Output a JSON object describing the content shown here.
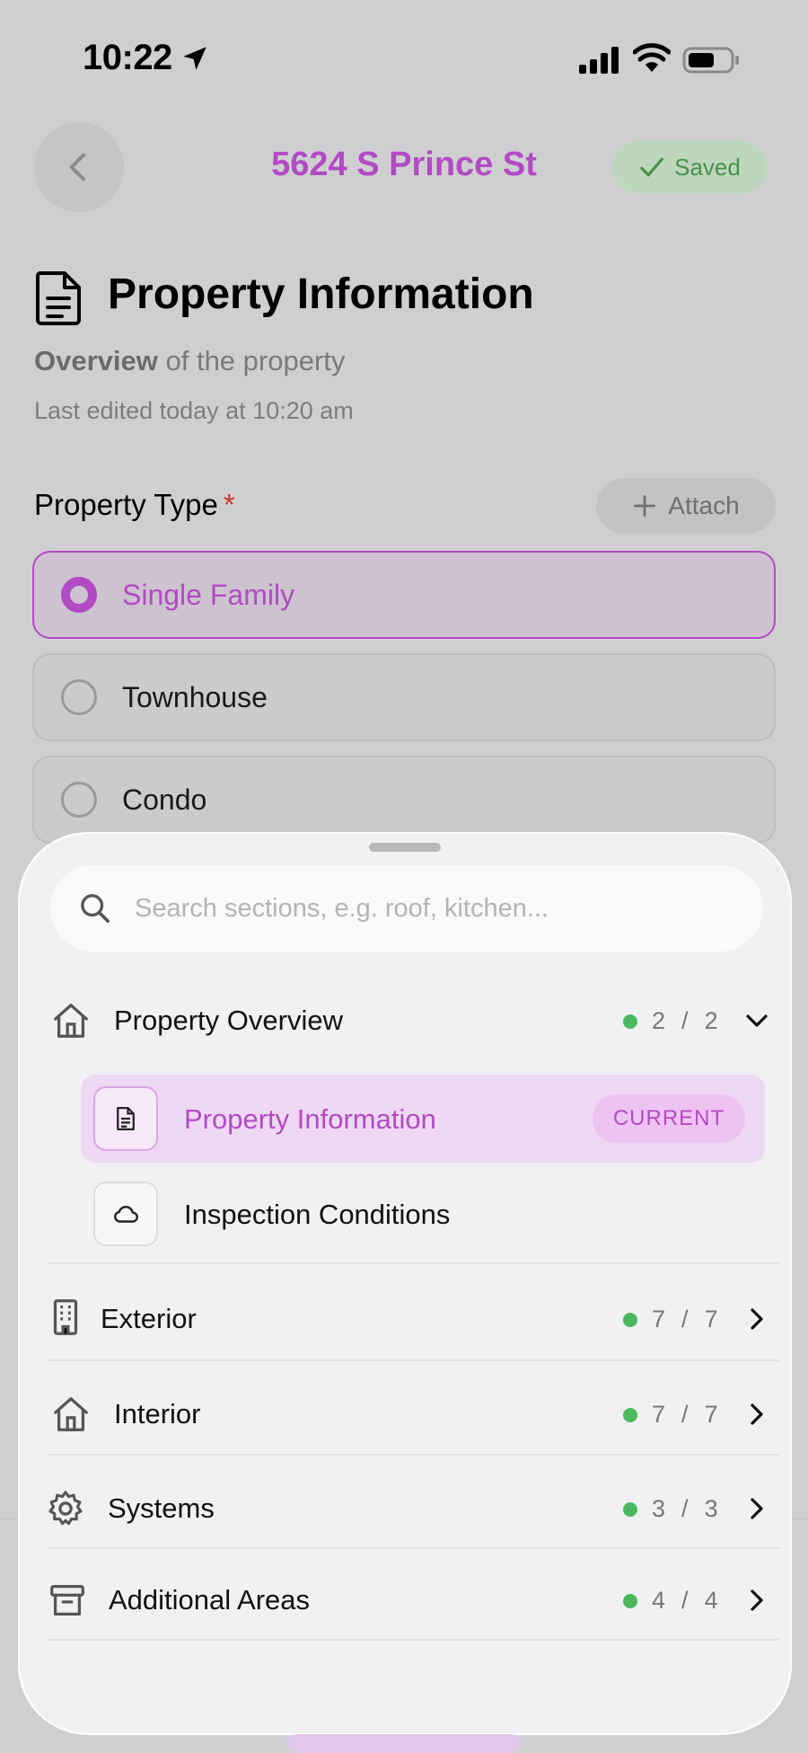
{
  "status_bar": {
    "time": "10:22"
  },
  "header": {
    "title": "5624 S Prince St",
    "saved_label": "Saved"
  },
  "page": {
    "title": "Property Information",
    "subtitle_bold": "Overview",
    "subtitle_rest": " of the property",
    "last_edited": "Last edited today at 10:20 am"
  },
  "field": {
    "label": "Property Type",
    "required_mark": "*",
    "attach_label": "Attach",
    "options": [
      "Single Family",
      "Townhouse",
      "Condo"
    ],
    "selected": "Single Family"
  },
  "sheet": {
    "search_placeholder": "Search sections, e.g. roof, kitchen...",
    "sections": [
      {
        "label": "Property Overview",
        "done": "2",
        "total": "2",
        "expanded": true,
        "icon": "house-icon"
      },
      {
        "label": "Exterior",
        "done": "7",
        "total": "7",
        "icon": "building-icon"
      },
      {
        "label": "Interior",
        "done": "7",
        "total": "7",
        "icon": "house-icon"
      },
      {
        "label": "Systems",
        "done": "3",
        "total": "3",
        "icon": "gear-icon"
      },
      {
        "label": "Additional Areas",
        "done": "4",
        "total": "4",
        "icon": "archive-box-icon"
      }
    ],
    "subsections": [
      {
        "label": "Property Information",
        "current": true,
        "icon": "document-icon"
      },
      {
        "label": "Inspection Conditions",
        "current": false,
        "icon": "cloud-icon"
      }
    ],
    "current_tag": "CURRENT",
    "separator": "/"
  },
  "colors": {
    "accent": "#b24bc3",
    "success": "#4cb85c",
    "required": "#c8312b"
  }
}
